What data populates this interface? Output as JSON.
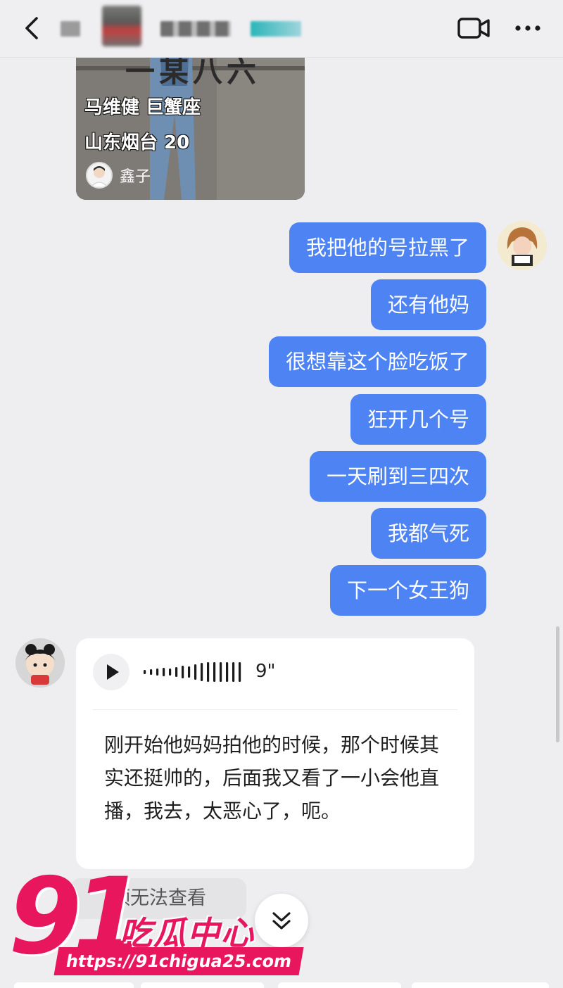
{
  "header": {
    "back_icon": "chevron-left-icon",
    "title_redacted": true,
    "video_icon": "video-camera-icon",
    "more_icon": "more-dots-icon"
  },
  "shared_card": {
    "banner": "一某八六",
    "line1": "马维健  巨蟹座",
    "line2": "山东烟台  20",
    "author": "鑫子"
  },
  "messages_outgoing": [
    {
      "text": "我把他的号拉黑了"
    },
    {
      "text": "还有他妈"
    },
    {
      "text": "很想靠这个脸吃饭了"
    },
    {
      "text": "狂开几个号"
    },
    {
      "text": "一天刷到三四次"
    },
    {
      "text": "我都气死"
    },
    {
      "text": "下一个女王狗"
    }
  ],
  "voice_message": {
    "duration": "9\"",
    "transcript": "刚开始他妈妈拍他的时候，那个时候其实还挺帅的，后面我又看了一小会他直播，我去，太恶心了，呃。"
  },
  "notice": {
    "text": "频无法查看"
  },
  "watermark": {
    "number": "91",
    "text": "吃瓜中心",
    "url": "https://91chigua25.com"
  },
  "colors": {
    "bubble_blue": "#4d83f3",
    "background": "#eeeef0",
    "watermark_pink": "#e8175d"
  }
}
